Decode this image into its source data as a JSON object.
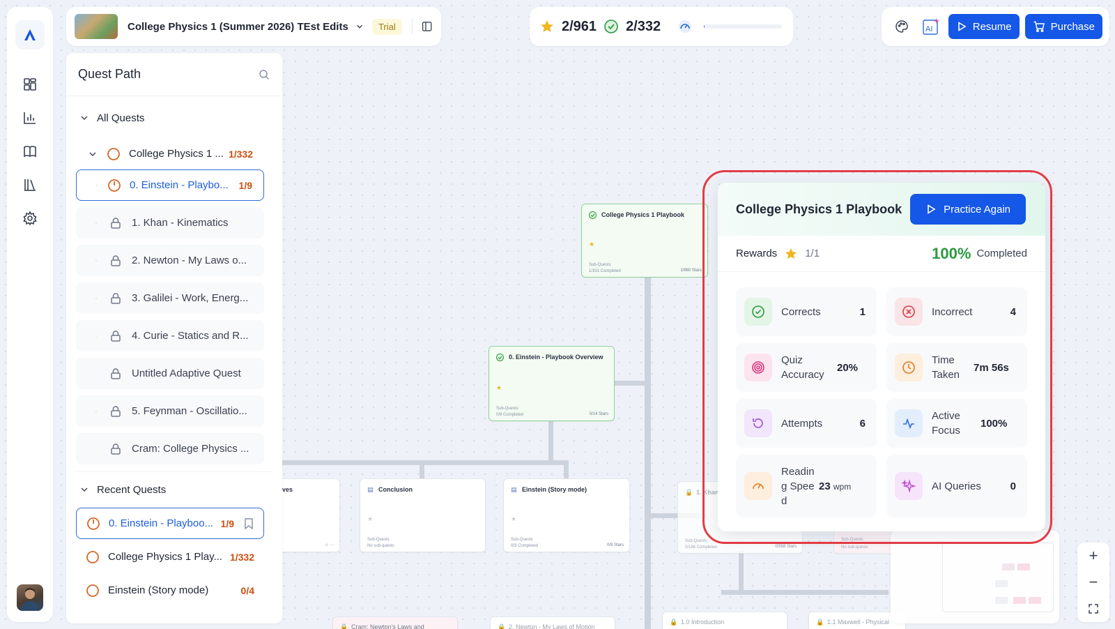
{
  "header": {
    "course_title": "College Physics 1 (Summer 2026) TEst Edits",
    "trial_badge": "Trial",
    "stars": "2/961",
    "completed": "2/332",
    "progress_fraction": 0.01
  },
  "actions": {
    "resume_label": "Resume",
    "purchase_label": "Purchase",
    "ai_label": "AI"
  },
  "panel": {
    "title": "Quest Path",
    "all_quests_label": "All Quests",
    "root": {
      "label": "College Physics 1 ...",
      "count": "1/332"
    },
    "items": [
      {
        "label": "0. Einstein - Playbo...",
        "count": "1/9"
      },
      {
        "label": "1. Khan - Kinematics"
      },
      {
        "label": "2. Newton - My Laws o..."
      },
      {
        "label": "3. Galilei - Work, Energ..."
      },
      {
        "label": "4. Curie - Statics and R..."
      },
      {
        "label": "Untitled Adaptive Quest"
      },
      {
        "label": "5. Feynman - Oscillatio..."
      },
      {
        "label": "Cram: College Physics ..."
      }
    ],
    "recent_label": "Recent Quests",
    "recent": [
      {
        "label": "0. Einstein - Playboo...",
        "count": "1/9"
      },
      {
        "label": "College Physics 1 Play...",
        "count": "1/332"
      },
      {
        "label": "Einstein (Story mode)",
        "count": "0/4"
      }
    ]
  },
  "canvas": {
    "cards": [
      {
        "title": "College Physics 1 Playbook",
        "sub1": "Sub-Quests",
        "sub2": "1/331 Completed",
        "stars": "1/960 Stars"
      },
      {
        "title": "0. Einstein - Playbook Overview",
        "sub1": "Sub-Quests",
        "sub2": "0/8 Completed",
        "stars": "0/14 Stars"
      },
      {
        "title": "ves"
      },
      {
        "title": "Conclusion",
        "sub1": "Sub-Quests",
        "sub2": "No sub-quests"
      },
      {
        "title": "Einstein (Story mode)",
        "sub1": "Sub-Quests",
        "sub2": "0/3 Completed",
        "stars": "0/9 Stars"
      },
      {
        "title": "1. Khan",
        "sub1": "Sub-Quests",
        "sub2": "0/186 Completed",
        "stars": "0/558 Stars"
      },
      {
        "sub1": "Sub-Quests",
        "sub2": "No sub-quests"
      },
      {
        "title": "Cram: Newton's Laws and"
      },
      {
        "title": "2. Newton - My Laws of Motion"
      },
      {
        "title": "1.0 Introduction"
      },
      {
        "title": "1.1 Maxwell - Physical"
      }
    ]
  },
  "popup": {
    "title": "College Physics 1 Playbook",
    "practice_label": "Practice Again",
    "rewards_label": "Rewards",
    "rewards_value": "1/1",
    "percent": "100%",
    "completed_label": "Completed",
    "metrics": [
      {
        "label": "Corrects",
        "value": "1"
      },
      {
        "label": "Incorrect",
        "value": "4"
      },
      {
        "label": "Quiz Accuracy",
        "value": "20%"
      },
      {
        "label": "Time Taken",
        "value": "7m 56s"
      },
      {
        "label": "Attempts",
        "value": "6"
      },
      {
        "label": "Active Focus",
        "value": "100%"
      },
      {
        "label": "Readin g Speed",
        "value": "23",
        "unit": "wpm"
      },
      {
        "label": "AI Queries",
        "value": "0"
      }
    ]
  },
  "zoom": {
    "in": "+",
    "out": "−"
  },
  "colors": {
    "accent": "#1557e6",
    "orange": "#c9500f",
    "success": "#2a9a3f",
    "star": "#f2b51f",
    "highlight": "#e23c45"
  }
}
